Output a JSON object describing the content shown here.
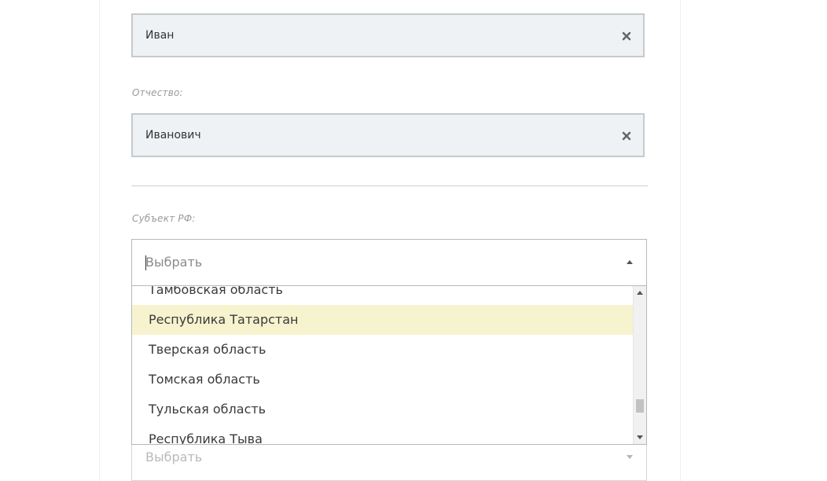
{
  "form": {
    "first_name": {
      "value": "Иван",
      "clear_icon": "close-icon"
    },
    "patronymic": {
      "label": "Отчество:",
      "value": "Иванович",
      "clear_icon": "close-icon"
    },
    "region": {
      "label": "Субъект РФ:",
      "placeholder": "Выбрать",
      "options": [
        "Тамбовская область",
        "Республика Татарстан",
        "Тверская область",
        "Томская область",
        "Тульская область",
        "Республика Тыва"
      ],
      "highlighted_option": "Республика Татарстан"
    },
    "next_select": {
      "placeholder": "Выбрать"
    }
  },
  "colors": {
    "field_bg": "#eef2f4",
    "field_border": "#c6cacc",
    "highlight": "#f8f3cf"
  }
}
